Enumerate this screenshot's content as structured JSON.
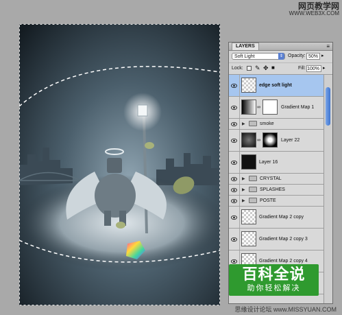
{
  "watermark_top": {
    "line1": "网页教学网",
    "line2": "WWW.WEB3X.COM"
  },
  "watermark_bottom": "思缘设计论坛 www.MISSYUAN.COM",
  "badge": {
    "title": "百科全说",
    "subtitle": "助你轻松解决"
  },
  "panel": {
    "tab_label": "LAYERS",
    "menu_icon": "panel-menu-icon",
    "blend_mode": "Soft Light",
    "opacity_label": "Opacity:",
    "opacity_value": "50%",
    "lock_label": "Lock:",
    "fill_label": "Fill:",
    "fill_value": "100%"
  },
  "layers": [
    {
      "name": "edge soft light",
      "kind": "layer",
      "selected": true
    },
    {
      "name": "Gradient Map 1",
      "kind": "adjustment"
    },
    {
      "name": "smoke",
      "kind": "group"
    },
    {
      "name": "Layer 22",
      "kind": "masked"
    },
    {
      "name": "Layer 16",
      "kind": "layer"
    },
    {
      "name": "CRYSTAL",
      "kind": "group"
    },
    {
      "name": "SPLASHES",
      "kind": "group"
    },
    {
      "name": "POSTE",
      "kind": "group"
    },
    {
      "name": "Gradient Map 2 copy",
      "kind": "layer"
    },
    {
      "name": "Gradient Map 2 copy 3",
      "kind": "layer"
    },
    {
      "name": "Gradient Map 2 copy 4",
      "kind": "layer"
    }
  ],
  "colors": {
    "selection_highlight": "#a6c6ef",
    "badge_green": "#2f9a2f"
  }
}
